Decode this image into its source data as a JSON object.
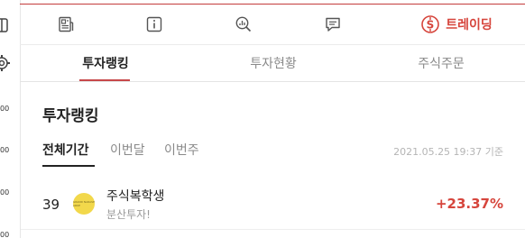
{
  "left_strip": {
    "ticks": [
      "00",
      "00",
      "00",
      "00"
    ]
  },
  "toolbar": {
    "icons": [
      "news-icon",
      "info-icon",
      "analysis-icon",
      "chat-icon"
    ],
    "trade_label": "트레이딩"
  },
  "tabs": [
    "투자랭킹",
    "투자현황",
    "주식주문"
  ],
  "section_title": "투자랭킹",
  "periods": [
    "전체기간",
    "이번달",
    "이번주"
  ],
  "timestamp": "2021.05.25 19:37 기준",
  "ranking": [
    {
      "rank": "39",
      "name": "주식복학생",
      "subtitle": "분산투자!",
      "rate": "+23.37%",
      "avatar_text": "GRAND NARASE ARKE"
    }
  ],
  "colors": {
    "accent": "#d6453c",
    "avatar": "#f2d84b"
  }
}
